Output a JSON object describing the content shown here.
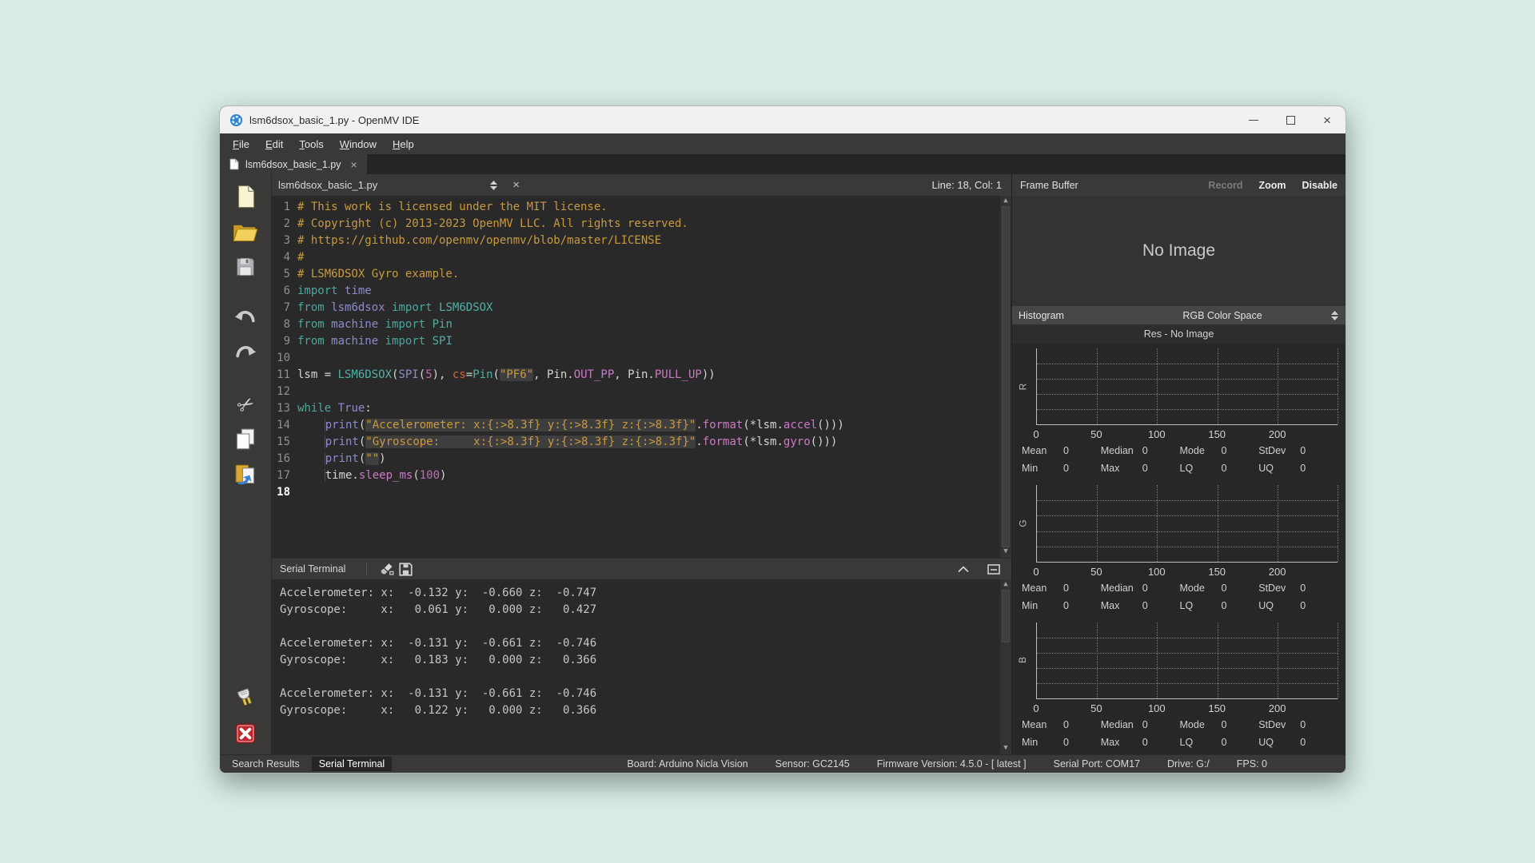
{
  "colors": {
    "desktop": "#d8ece8",
    "titlebar_bg": "#f2f1ef",
    "panel": "#3a3938",
    "panel_dark": "#262524",
    "editor_bg": "#2a2929",
    "c_comment": "#c89a3f",
    "c_kw": "#4ba79c",
    "c_name": "#8c8ccc",
    "c_cls": "#50b0a6",
    "c_num": "#c16bb4",
    "c_attr": "#cc79c5",
    "c_arg": "#c96a3a",
    "c_str": "#c89a3f",
    "logo_blue": "#2e86d1",
    "stop_red": "#c1272d",
    "folder_yellow": "#f3cf5e"
  },
  "window": {
    "title": "lsm6dsox_basic_1.py - OpenMV IDE"
  },
  "icons": {
    "close_glyph": "×",
    "cut_glyph": "✂"
  },
  "menu": {
    "items": [
      "File",
      "Edit",
      "Tools",
      "Window",
      "Help"
    ]
  },
  "tab": {
    "label": "lsm6dsox_basic_1.py"
  },
  "editor": {
    "doc_name": "lsm6dsox_basic_1.py",
    "cursor": "Line: 18, Col: 1",
    "lines": [
      {
        "n": "1",
        "segs": [
          {
            "c": "c",
            "t": "# This work is licensed under the MIT license."
          }
        ]
      },
      {
        "n": "2",
        "segs": [
          {
            "c": "c",
            "t": "# Copyright (c) 2013-2023 OpenMV LLC. All rights reserved."
          }
        ]
      },
      {
        "n": "3",
        "segs": [
          {
            "c": "c",
            "t": "# https://github.com/openmv/openmv/blob/master/LICENSE"
          }
        ]
      },
      {
        "n": "4",
        "segs": [
          {
            "c": "c",
            "t": "#"
          }
        ]
      },
      {
        "n": "5",
        "segs": [
          {
            "c": "c",
            "t": "# LSM6DSOX Gyro example."
          }
        ]
      },
      {
        "n": "6",
        "segs": [
          {
            "c": "k",
            "t": "import"
          },
          {
            "c": "p",
            "t": " "
          },
          {
            "c": "n",
            "t": "time"
          }
        ]
      },
      {
        "n": "7",
        "segs": [
          {
            "c": "k",
            "t": "from"
          },
          {
            "c": "p",
            "t": " "
          },
          {
            "c": "n",
            "t": "lsm6dsox"
          },
          {
            "c": "p",
            "t": " "
          },
          {
            "c": "k",
            "t": "import"
          },
          {
            "c": "p",
            "t": " "
          },
          {
            "c": "cl",
            "t": "LSM6DSOX"
          }
        ]
      },
      {
        "n": "8",
        "segs": [
          {
            "c": "k",
            "t": "from"
          },
          {
            "c": "p",
            "t": " "
          },
          {
            "c": "n",
            "t": "machine"
          },
          {
            "c": "p",
            "t": " "
          },
          {
            "c": "k",
            "t": "import"
          },
          {
            "c": "p",
            "t": " "
          },
          {
            "c": "cl",
            "t": "Pin"
          }
        ]
      },
      {
        "n": "9",
        "segs": [
          {
            "c": "k",
            "t": "from"
          },
          {
            "c": "p",
            "t": " "
          },
          {
            "c": "n",
            "t": "machine"
          },
          {
            "c": "p",
            "t": " "
          },
          {
            "c": "k",
            "t": "import"
          },
          {
            "c": "p",
            "t": " "
          },
          {
            "c": "cl",
            "t": "SPI"
          }
        ]
      },
      {
        "n": "10",
        "segs": []
      },
      {
        "n": "11",
        "segs": [
          {
            "c": "p",
            "t": "lsm = "
          },
          {
            "c": "cl",
            "t": "LSM6DSOX"
          },
          {
            "c": "p",
            "t": "("
          },
          {
            "c": "n",
            "t": "SPI"
          },
          {
            "c": "p",
            "t": "("
          },
          {
            "c": "nu",
            "t": "5"
          },
          {
            "c": "p",
            "t": "), "
          },
          {
            "c": "g",
            "t": "cs"
          },
          {
            "c": "p",
            "t": "="
          },
          {
            "c": "cl",
            "t": "Pin"
          },
          {
            "c": "p",
            "t": "("
          },
          {
            "c": "s",
            "t": "\"PF6\""
          },
          {
            "c": "p",
            "t": ", Pin."
          },
          {
            "c": "a",
            "t": "OUT_PP"
          },
          {
            "c": "p",
            "t": ", Pin."
          },
          {
            "c": "a",
            "t": "PULL_UP"
          },
          {
            "c": "p",
            "t": "))"
          }
        ]
      },
      {
        "n": "12",
        "segs": []
      },
      {
        "n": "13",
        "segs": [
          {
            "c": "k",
            "t": "while"
          },
          {
            "c": "p",
            "t": " "
          },
          {
            "c": "n",
            "t": "True"
          },
          {
            "c": "p",
            "t": ":"
          }
        ]
      },
      {
        "n": "14",
        "segs": [
          {
            "c": "i",
            "t": "    "
          },
          {
            "c": "n",
            "t": "print"
          },
          {
            "c": "p",
            "t": "("
          },
          {
            "c": "s",
            "t": "\"Accelerometer: x:{:>8.3f} y:{:>8.3f} z:{:>8.3f}\""
          },
          {
            "c": "p",
            "t": "."
          },
          {
            "c": "a",
            "t": "format"
          },
          {
            "c": "p",
            "t": "(*lsm."
          },
          {
            "c": "a",
            "t": "accel"
          },
          {
            "c": "p",
            "t": "()))"
          }
        ]
      },
      {
        "n": "15",
        "segs": [
          {
            "c": "i",
            "t": "    "
          },
          {
            "c": "n",
            "t": "print"
          },
          {
            "c": "p",
            "t": "("
          },
          {
            "c": "s",
            "t": "\"Gyroscope:     x:{:>8.3f} y:{:>8.3f} z:{:>8.3f}\""
          },
          {
            "c": "p",
            "t": "."
          },
          {
            "c": "a",
            "t": "format"
          },
          {
            "c": "p",
            "t": "(*lsm."
          },
          {
            "c": "a",
            "t": "gyro"
          },
          {
            "c": "p",
            "t": "()))"
          }
        ]
      },
      {
        "n": "16",
        "segs": [
          {
            "c": "i",
            "t": "    "
          },
          {
            "c": "n",
            "t": "print"
          },
          {
            "c": "p",
            "t": "("
          },
          {
            "c": "s",
            "t": "\"\""
          },
          {
            "c": "p",
            "t": ")"
          }
        ]
      },
      {
        "n": "17",
        "segs": [
          {
            "c": "i",
            "t": "    "
          },
          {
            "c": "p",
            "t": "time."
          },
          {
            "c": "a",
            "t": "sleep_ms"
          },
          {
            "c": "p",
            "t": "("
          },
          {
            "c": "nu",
            "t": "100"
          },
          {
            "c": "p",
            "t": ")"
          }
        ]
      },
      {
        "n": "18",
        "cur": true,
        "segs": []
      }
    ]
  },
  "terminal": {
    "title": "Serial Terminal",
    "lines": [
      "Accelerometer: x:  -0.132 y:  -0.660 z:  -0.747",
      "Gyroscope:     x:   0.061 y:   0.000 z:   0.427",
      "",
      "Accelerometer: x:  -0.131 y:  -0.661 z:  -0.746",
      "Gyroscope:     x:   0.183 y:   0.000 z:   0.366",
      "",
      "Accelerometer: x:  -0.131 y:  -0.661 z:  -0.746",
      "Gyroscope:     x:   0.122 y:   0.000 z:   0.366"
    ]
  },
  "frame_buffer": {
    "title": "Frame Buffer",
    "record": "Record",
    "zoom": "Zoom",
    "disable": "Disable",
    "no_image": "No Image"
  },
  "histogram": {
    "title": "Histogram",
    "color_space": "RGB Color Space",
    "res": "Res - No Image",
    "ticks": [
      "0",
      "50",
      "100",
      "150",
      "200"
    ],
    "channels": [
      {
        "label": "R",
        "stats": [
          {
            "k": "Mean",
            "v": "0"
          },
          {
            "k": "Median",
            "v": "0"
          },
          {
            "k": "Mode",
            "v": "0"
          },
          {
            "k": "StDev",
            "v": "0"
          },
          {
            "k": "Min",
            "v": "0"
          },
          {
            "k": "Max",
            "v": "0"
          },
          {
            "k": "LQ",
            "v": "0"
          },
          {
            "k": "UQ",
            "v": "0"
          }
        ]
      },
      {
        "label": "G",
        "stats": [
          {
            "k": "Mean",
            "v": "0"
          },
          {
            "k": "Median",
            "v": "0"
          },
          {
            "k": "Mode",
            "v": "0"
          },
          {
            "k": "StDev",
            "v": "0"
          },
          {
            "k": "Min",
            "v": "0"
          },
          {
            "k": "Max",
            "v": "0"
          },
          {
            "k": "LQ",
            "v": "0"
          },
          {
            "k": "UQ",
            "v": "0"
          }
        ]
      },
      {
        "label": "B",
        "stats": [
          {
            "k": "Mean",
            "v": "0"
          },
          {
            "k": "Median",
            "v": "0"
          },
          {
            "k": "Mode",
            "v": "0"
          },
          {
            "k": "StDev",
            "v": "0"
          },
          {
            "k": "Min",
            "v": "0"
          },
          {
            "k": "Max",
            "v": "0"
          },
          {
            "k": "LQ",
            "v": "0"
          },
          {
            "k": "UQ",
            "v": "0"
          }
        ]
      }
    ]
  },
  "toolbar": {
    "icons": [
      "new-file",
      "open-file",
      "save-file",
      "undo",
      "redo",
      "cut",
      "copy",
      "paste",
      "connect",
      "stop"
    ]
  },
  "status_bar": {
    "left": [
      {
        "label": "Search Results",
        "active": false
      },
      {
        "label": "Serial Terminal",
        "active": true
      }
    ],
    "right": [
      "Board: Arduino Nicla Vision",
      "Sensor: GC2145",
      "Firmware Version: 4.5.0 - [ latest ]",
      "Serial Port: COM17",
      "Drive: G:/",
      "FPS: 0"
    ]
  }
}
